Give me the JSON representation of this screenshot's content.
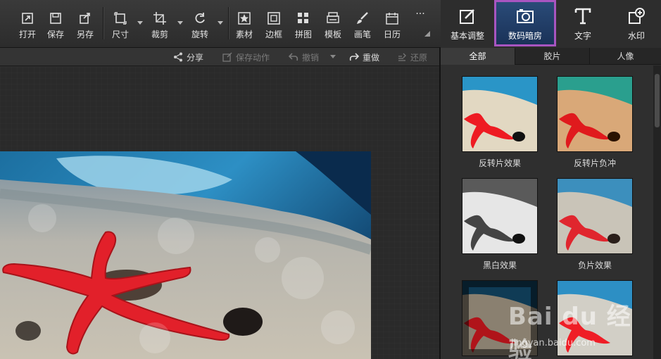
{
  "toolbar": {
    "open": "打开",
    "save": "保存",
    "save_as": "另存",
    "size": "尺寸",
    "crop": "裁剪",
    "rotate": "旋转",
    "material": "素材",
    "border": "边框",
    "collage": "拼图",
    "template": "模板",
    "brush": "画笔",
    "calendar": "日历",
    "more": "···"
  },
  "right_tools": {
    "basic": "基本调整",
    "darkroom": "数码暗房",
    "text": "文字",
    "watermark": "水印"
  },
  "subbar": {
    "share": "分享",
    "save_action": "保存动作",
    "undo": "撤销",
    "redo": "重做",
    "restore": "还原"
  },
  "panel": {
    "tabs": [
      "全部",
      "胶片",
      "人像"
    ],
    "effects": [
      "反转片效果",
      "反转片负冲",
      "黑白效果",
      "负片效果"
    ]
  },
  "watermark": {
    "brand": "Bai du 经验",
    "url": "jingyan.baidu.com"
  },
  "colors": {
    "active_border": "#a855c0",
    "active_bg": "#1f3a66"
  }
}
